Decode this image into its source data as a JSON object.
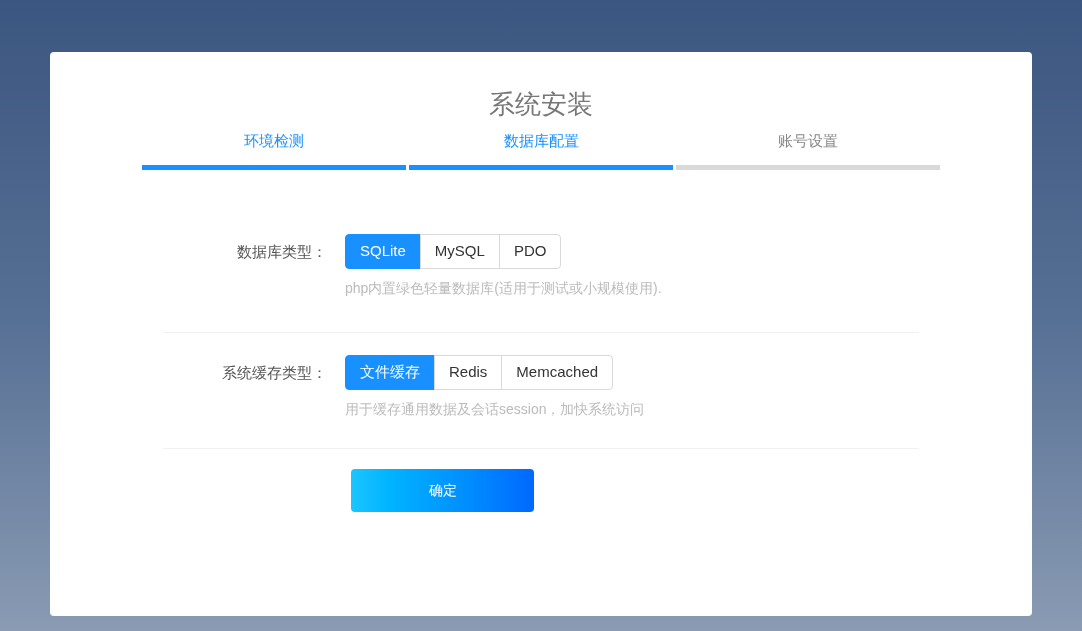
{
  "title": "系统安装",
  "steps": [
    {
      "label": "环境检测",
      "done": true
    },
    {
      "label": "数据库配置",
      "done": true
    },
    {
      "label": "账号设置",
      "done": false
    }
  ],
  "fields": [
    {
      "label": "数据库类型：",
      "options": [
        {
          "label": "SQLite",
          "selected": true
        },
        {
          "label": "MySQL",
          "selected": false
        },
        {
          "label": "PDO",
          "selected": false
        }
      ],
      "hint": "php内置绿色轻量数据库(适用于测试或小规模使用)."
    },
    {
      "label": "系统缓存类型：",
      "options": [
        {
          "label": "文件缓存",
          "selected": true
        },
        {
          "label": "Redis",
          "selected": false
        },
        {
          "label": "Memcached",
          "selected": false
        }
      ],
      "hint": "用于缓存通用数据及会话session，加快系统访问"
    }
  ],
  "submit": "确定"
}
